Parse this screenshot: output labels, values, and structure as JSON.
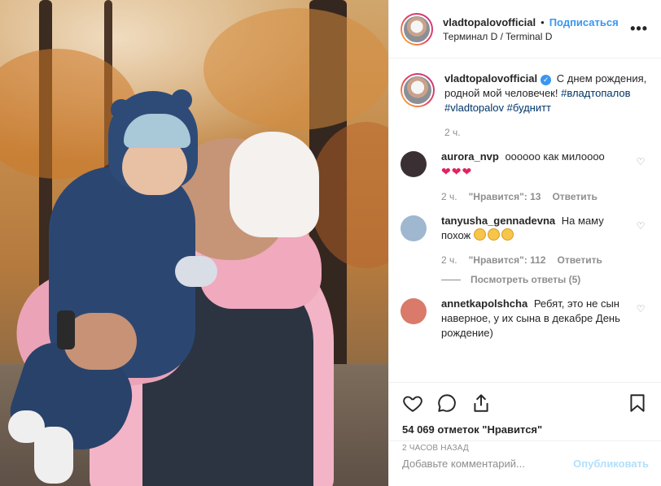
{
  "header": {
    "username": "vladtopalovofficial",
    "dot": "•",
    "follow_label": "Подписаться",
    "location": "Терминал D / Terminal D",
    "more_label": "•••"
  },
  "caption": {
    "username": "vladtopalovofficial",
    "verified_icon": "verified-badge-icon",
    "text": "С днем рождения, родной мой человечек!",
    "hashtags": "#владтопалов #vladtopalov #буднитт",
    "age": "2 ч."
  },
  "comments": [
    {
      "username": "aurora_nvp",
      "text": "оооооо как милоооо",
      "emoji": "❤❤❤",
      "age": "2 ч.",
      "likes": "\"Нравится\": 13",
      "reply_label": "Ответить",
      "avatar_color": "#3a3033"
    },
    {
      "username": "tanyusha_gennadevna",
      "text": "На маму похож",
      "emoji_count": "3",
      "age": "2 ч.",
      "likes": "\"Нравится\": 112",
      "reply_label": "Ответить",
      "view_replies": "Посмотреть ответы (5)",
      "avatar_color": "#9fb7cf"
    },
    {
      "username": "annetkapolshcha",
      "text": "Ребят, это не сын наверное, у их сына в декабре День рождение)",
      "avatar_color": "#d97a6a"
    }
  ],
  "actions": {
    "like_icon": "heart-icon",
    "comment_icon": "comment-icon",
    "share_icon": "share-icon",
    "save_icon": "bookmark-icon",
    "likes_text": "54 069 отметок \"Нравится\"",
    "timestamp": "2 часов назад"
  },
  "add_comment": {
    "placeholder": "Добавьте комментарий...",
    "publish_label": "Опубликовать"
  },
  "colors": {
    "link_blue": "#3897f0",
    "publish_disabled": "#b2dffc",
    "muted": "#8e8e8e",
    "hashtag": "#003569"
  }
}
